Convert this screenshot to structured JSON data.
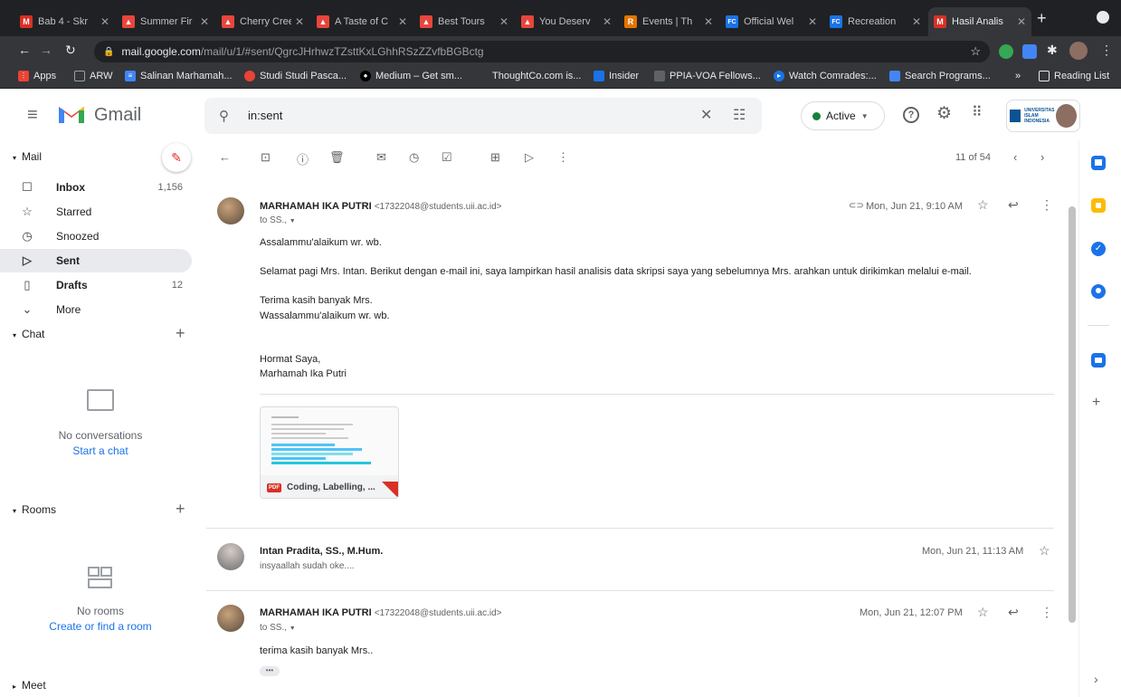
{
  "browser": {
    "tabs": [
      {
        "label": "Bab 4 - Skr",
        "color": "#d93025",
        "glyph": "M"
      },
      {
        "label": "Summer Fir",
        "color": "#e8453c",
        "glyph": "▲"
      },
      {
        "label": "Cherry Cree",
        "color": "#e8453c",
        "glyph": "▲"
      },
      {
        "label": "A Taste of C",
        "color": "#e8453c",
        "glyph": "▲"
      },
      {
        "label": "Best Tours",
        "color": "#e8453c",
        "glyph": "▲"
      },
      {
        "label": "You Deserv",
        "color": "#e8453c",
        "glyph": "▲"
      },
      {
        "label": "Events | Th",
        "color": "#e37400",
        "glyph": "R"
      },
      {
        "label": "Official Wel",
        "color": "#1a73e8",
        "glyph": "FC"
      },
      {
        "label": "Recreation",
        "color": "#1a73e8",
        "glyph": "FC"
      },
      {
        "label": "Hasil Analis",
        "color": "#d93025",
        "glyph": "M"
      }
    ],
    "url_domain": "mail.google.com",
    "url_path": "/mail/u/1/#sent/QgrcJHrhwzTZsttKxLGhhRSzZZvfbBGBctg",
    "bookmarks": [
      {
        "label": "Apps",
        "color": "#ea4335"
      },
      {
        "label": "ARW",
        "color": "#9aa0a6"
      },
      {
        "label": "Salinan Marhamah...",
        "color": "#4285f4"
      },
      {
        "label": "Studi Studi Pasca...",
        "color": "#ea4335"
      },
      {
        "label": "Medium – Get sm...",
        "color": "#000000"
      },
      {
        "label": "ThoughtCo.com is...",
        "color": "#35363a"
      },
      {
        "label": "Insider",
        "color": "#1a73e8"
      },
      {
        "label": "PPIA-VOA Fellows...",
        "color": "#5f6368"
      },
      {
        "label": "Watch Comrades:...",
        "color": "#1a73e8"
      },
      {
        "label": "Search Programs...",
        "color": "#4285f4"
      }
    ],
    "reading_list": "Reading List"
  },
  "gmail": {
    "logo_text": "Gmail",
    "search_value": "in:sent",
    "status": "Active",
    "org_logo": "UNIVERSITAS ISLAM INDONESIA"
  },
  "sidebar": {
    "mail_label": "Mail",
    "items": [
      {
        "label": "Inbox",
        "count": "1,156",
        "icon": "inbox-icon"
      },
      {
        "label": "Starred",
        "count": "",
        "icon": "star-icon"
      },
      {
        "label": "Snoozed",
        "count": "",
        "icon": "clock-icon"
      },
      {
        "label": "Sent",
        "count": "",
        "icon": "send-icon"
      },
      {
        "label": "Drafts",
        "count": "12",
        "icon": "draft-icon"
      },
      {
        "label": "More",
        "count": "",
        "icon": "chevron-down-icon"
      }
    ],
    "chat_label": "Chat",
    "no_conversations": "No conversations",
    "start_chat": "Start a chat",
    "rooms_label": "Rooms",
    "no_rooms": "No rooms",
    "create_room": "Create or find a room",
    "meet_label": "Meet"
  },
  "toolbar": {
    "counter": "11 of 54"
  },
  "messages": [
    {
      "sender": "MARHAMAH IKA PUTRI",
      "email": "<17322048@students.uii.ac.id>",
      "to": "to SS.,",
      "date": "Mon, Jun 21, 9:10 AM",
      "lines": [
        "Assalammu'alaikum wr. wb.",
        "Selamat pagi Mrs. Intan. Berikut dengan e-mail ini, saya lampirkan hasil analisis data skripsi saya yang sebelumnya Mrs. arahkan untuk dirikimkan melalui e-mail.",
        "Terima kasih banyak Mrs.",
        "Wassalammu'alaikum wr. wb.",
        "Hormat Saya,",
        "Marhamah Ika Putri"
      ],
      "attachment": "Coding, Labelling, ..."
    },
    {
      "sender": "Intan Pradita, SS., M.Hum.",
      "snippet": "insyaallah sudah oke....",
      "date": "Mon, Jun 21, 11:13 AM"
    },
    {
      "sender": "MARHAMAH IKA PUTRI",
      "email": "<17322048@students.uii.ac.id>",
      "to": "to SS.,",
      "date": "Mon, Jun 21, 12:07 PM",
      "lines": [
        "terima kasih banyak Mrs.."
      ],
      "more": "•••"
    }
  ]
}
